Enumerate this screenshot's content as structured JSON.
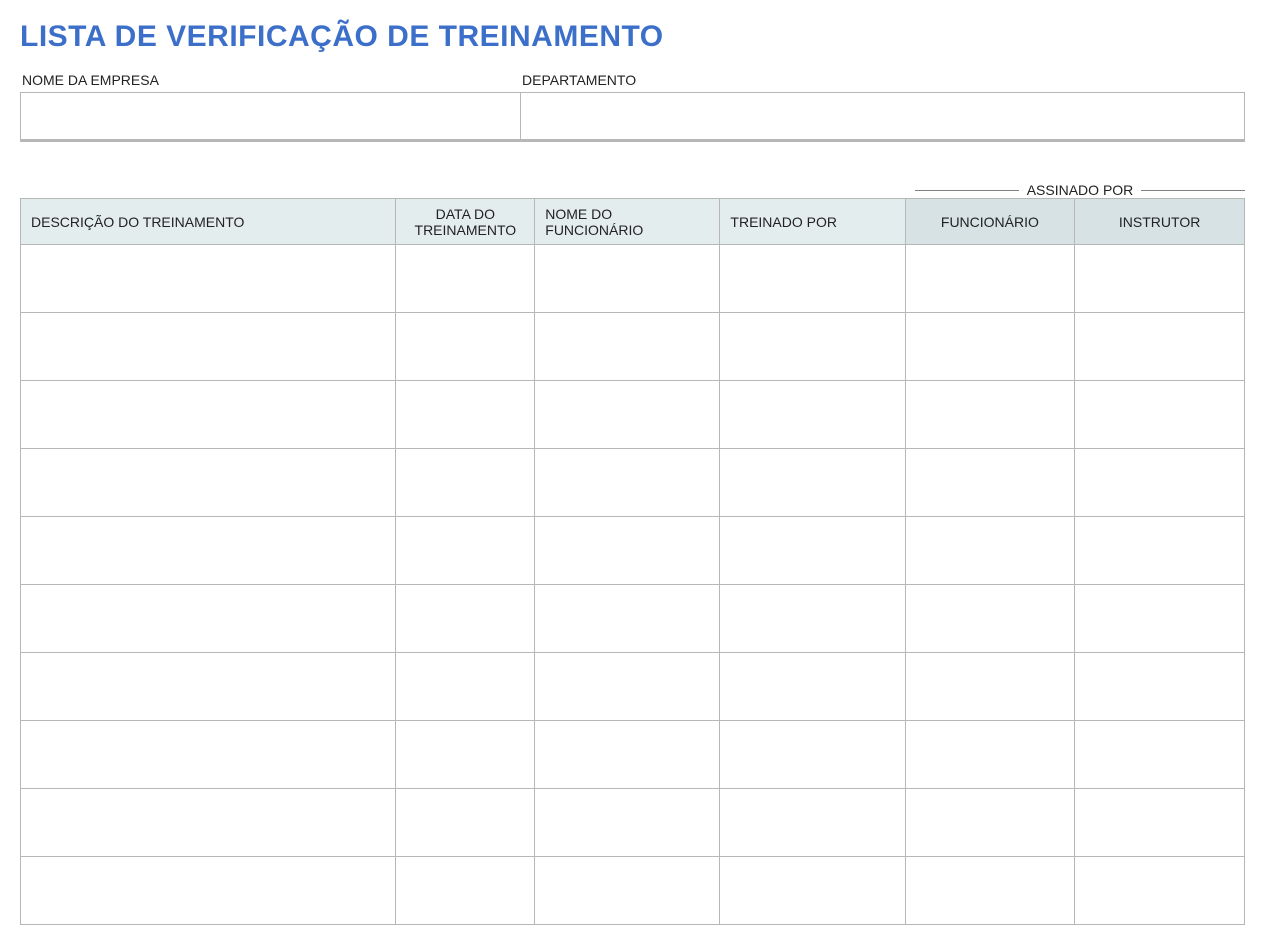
{
  "title": "LISTA DE VERIFICAÇÃO DE TREINAMENTO",
  "header": {
    "company_label": "NOME DA EMPRESA",
    "company_value": "",
    "department_label": "DEPARTAMENTO",
    "department_value": ""
  },
  "signed_by_label": "ASSINADO POR",
  "table": {
    "columns": {
      "description": "DESCRIÇÃO DO TREINAMENTO",
      "date": "DATA DO TREINAMENTO",
      "employee_name": "NOME DO FUNCIONÁRIO",
      "trained_by": "TREINADO POR",
      "employee_sig": "FUNCIONÁRIO",
      "instructor_sig": "INSTRUTOR"
    },
    "rows": [
      {
        "description": "",
        "date": "",
        "employee_name": "",
        "trained_by": "",
        "employee_sig": "",
        "instructor_sig": ""
      },
      {
        "description": "",
        "date": "",
        "employee_name": "",
        "trained_by": "",
        "employee_sig": "",
        "instructor_sig": ""
      },
      {
        "description": "",
        "date": "",
        "employee_name": "",
        "trained_by": "",
        "employee_sig": "",
        "instructor_sig": ""
      },
      {
        "description": "",
        "date": "",
        "employee_name": "",
        "trained_by": "",
        "employee_sig": "",
        "instructor_sig": ""
      },
      {
        "description": "",
        "date": "",
        "employee_name": "",
        "trained_by": "",
        "employee_sig": "",
        "instructor_sig": ""
      },
      {
        "description": "",
        "date": "",
        "employee_name": "",
        "trained_by": "",
        "employee_sig": "",
        "instructor_sig": ""
      },
      {
        "description": "",
        "date": "",
        "employee_name": "",
        "trained_by": "",
        "employee_sig": "",
        "instructor_sig": ""
      },
      {
        "description": "",
        "date": "",
        "employee_name": "",
        "trained_by": "",
        "employee_sig": "",
        "instructor_sig": ""
      },
      {
        "description": "",
        "date": "",
        "employee_name": "",
        "trained_by": "",
        "employee_sig": "",
        "instructor_sig": ""
      },
      {
        "description": "",
        "date": "",
        "employee_name": "",
        "trained_by": "",
        "employee_sig": "",
        "instructor_sig": ""
      }
    ]
  }
}
